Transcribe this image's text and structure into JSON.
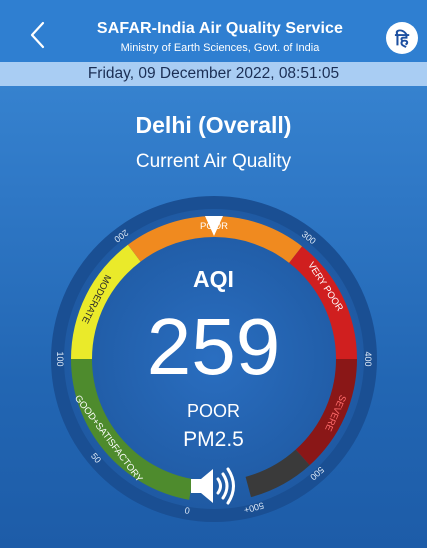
{
  "header": {
    "title": "SAFAR-India Air Quality Service",
    "subtitle": "Ministry of Earth Sciences, Govt. of India",
    "language_button": "हि"
  },
  "date_time": "Friday, 09 December 2022, 08:51:05",
  "location": "Delhi (Overall)",
  "heading": "Current Air Quality",
  "gauge": {
    "aqi_label": "AQI",
    "aqi_value": "259",
    "status": "POOR",
    "pollutant": "PM2.5",
    "categories": [
      "GOOD+SATISFACTORY",
      "MODERATE",
      "POOR",
      "VERY POOR",
      "SEVERE"
    ],
    "tick_labels": [
      "0",
      "50",
      "100",
      "200",
      "300",
      "400",
      "500",
      "500+"
    ],
    "colors": {
      "good": "#4e8b2d",
      "moderate": "#eaea2a",
      "poor": "#f08a1f",
      "very_poor": "#d01f1f",
      "severe": "#8a1717",
      "beyond": "#3a3a3a",
      "dial": "#1f5aa3"
    }
  }
}
